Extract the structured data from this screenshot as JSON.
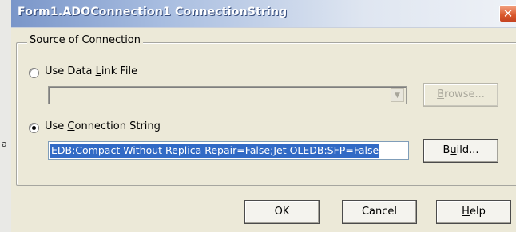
{
  "window": {
    "title": "Form1.ADOConnection1 ConnectionString",
    "close_glyph": "✕"
  },
  "background_fragment": "a",
  "source_group": {
    "legend": "Source of Connection"
  },
  "data_link_option": {
    "label_pre": "Use Data ",
    "label_accel": "L",
    "label_post": "ink File",
    "selected": false,
    "combo_value": "",
    "combo_enabled": false,
    "browse_pre": "",
    "browse_accel": "B",
    "browse_post": "rowse...",
    "browse_enabled": false
  },
  "connection_string_option": {
    "label_pre": "Use ",
    "label_accel": "C",
    "label_post": "onnection String",
    "selected": true,
    "value": "EDB:Compact Without Replica Repair=False;Jet OLEDB:SFP=False",
    "build_pre": "B",
    "build_accel": "u",
    "build_post": "ild..."
  },
  "footer_buttons": {
    "ok": "OK",
    "cancel": "Cancel",
    "help_accel": "H",
    "help_post": "elp"
  },
  "icons": {
    "close": "close-icon",
    "dropdown": "chevron-down-icon"
  }
}
